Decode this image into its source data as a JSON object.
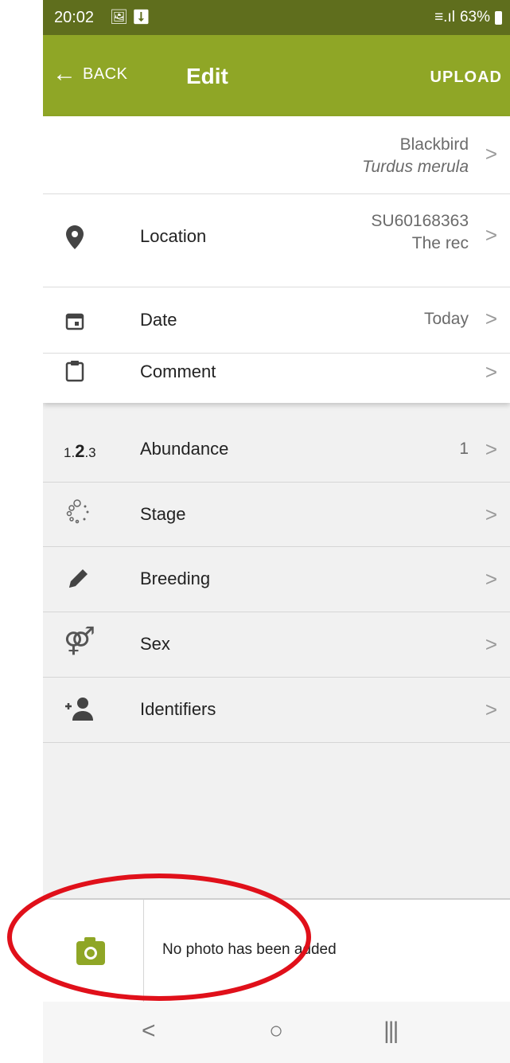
{
  "status_bar": {
    "time": "20:02",
    "left_icons": "🖼 ⬇",
    "signal": "≡.ıl",
    "battery": "63%"
  },
  "app_bar": {
    "back_label": "BACK",
    "title": "Edit",
    "upload_label": "UPLOAD"
  },
  "species": {
    "common_name": "Blackbird",
    "scientific_name": "Turdus merula"
  },
  "details": [
    {
      "label": "Location",
      "value_line1": "SU60168363",
      "value_line2": "The rec",
      "icon": "location-pin-icon"
    },
    {
      "label": "Date",
      "value_line1": "Today",
      "icon": "calendar-icon"
    },
    {
      "label": "Comment",
      "value_line1": "",
      "icon": "clipboard-icon"
    }
  ],
  "attributes": [
    {
      "label": "Abundance",
      "value": "1",
      "icon_text": "1.2.3",
      "icon": "number-sequence-icon"
    },
    {
      "label": "Stage",
      "value": "",
      "icon": "stage-dots-icon"
    },
    {
      "label": "Breeding",
      "value": "",
      "icon": "pencil-icon"
    },
    {
      "label": "Sex",
      "value": "",
      "icon": "gender-icon"
    },
    {
      "label": "Identifiers",
      "value": "",
      "icon": "add-person-icon"
    }
  ],
  "photo": {
    "empty_text": "No photo has been added",
    "icon": "camera-icon"
  },
  "nav": {
    "back_glyph": "<",
    "home_glyph": "○",
    "recent_glyph": "|||"
  },
  "colors": {
    "accent": "#8fa626",
    "status_bar": "#5f6e1d",
    "annotation": "#e0101a"
  }
}
